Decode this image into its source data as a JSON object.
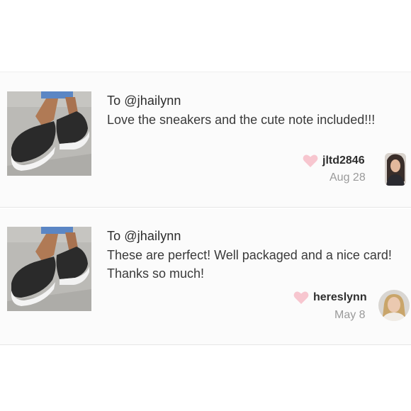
{
  "reviews": [
    {
      "to": "To @jhailynn",
      "text": "Love the sneakers and the cute note included!!!",
      "user": "jltd2846",
      "date": "Aug 28",
      "thumbnail": "black-slip-on-sneakers-photo",
      "avatar": "user-avatar-photo"
    },
    {
      "to": "To @jhailynn",
      "text": "These are perfect! Well packaged and a nice card! Thanks so much!",
      "user": "hereslynn",
      "date": "May 8",
      "thumbnail": "black-slip-on-sneakers-photo",
      "avatar": "user-avatar-photo"
    }
  ],
  "colors": {
    "heart": "#f7c6cf",
    "date": "#9a9a9a",
    "divider": "#e6e6e6"
  }
}
